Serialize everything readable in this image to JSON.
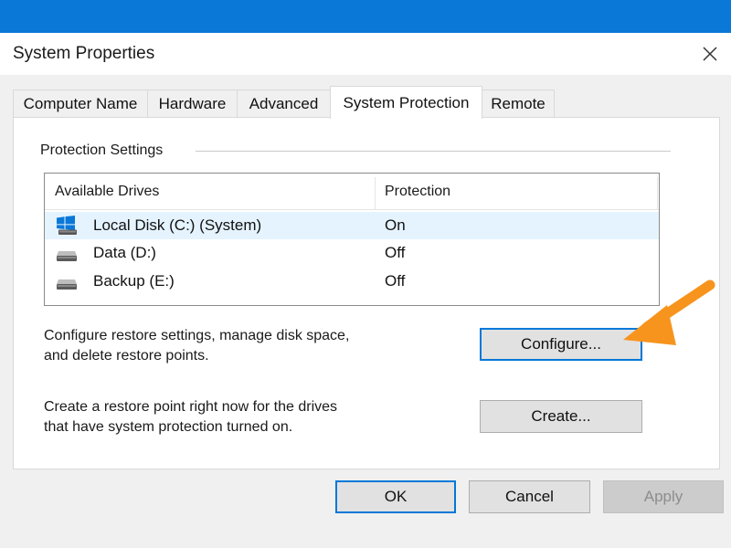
{
  "window": {
    "title": "System Properties"
  },
  "tabs": [
    {
      "label": "Computer Name"
    },
    {
      "label": "Hardware"
    },
    {
      "label": "Advanced"
    },
    {
      "label": "System Protection"
    },
    {
      "label": "Remote"
    }
  ],
  "active_tab": "System Protection",
  "protection": {
    "group_label": "Protection Settings",
    "columns": [
      "Available Drives",
      "Protection"
    ],
    "drives": [
      {
        "name": "Local Disk (C:) (System)",
        "protection": "On",
        "icon": "windows-drive-icon",
        "selected": true
      },
      {
        "name": "Data (D:)",
        "protection": "Off",
        "icon": "hard-drive-icon",
        "selected": false
      },
      {
        "name": "Backup (E:)",
        "protection": "Off",
        "icon": "hard-drive-icon",
        "selected": false
      }
    ]
  },
  "configure": {
    "description_line1": "Configure restore settings, manage disk space,",
    "description_line2": "and delete restore points.",
    "button_label": "Configure..."
  },
  "create": {
    "description_line1": "Create a restore point right now for the drives",
    "description_line2": "that have system protection turned on.",
    "button_label": "Create..."
  },
  "footer": {
    "ok_label": "OK",
    "cancel_label": "Cancel",
    "apply_label": "Apply"
  },
  "colors": {
    "title_bar_accent": "#0a78d7",
    "selected_row": "#e5f3ff",
    "annotation_arrow": "#f7941d"
  }
}
